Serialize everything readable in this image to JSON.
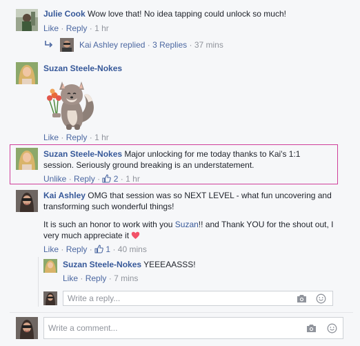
{
  "comments": [
    {
      "author": "Julie Cook",
      "text": "Wow love that! No idea tapping could unlock so much!",
      "actions": {
        "like": "Like",
        "reply": "Reply",
        "time": "1 hr"
      },
      "replies_summary": {
        "author": "Kai Ashley",
        "verb": "replied",
        "count": "3 Replies",
        "time": "37 mins"
      }
    },
    {
      "author": "Suzan Steele-Nokes",
      "sticker": "fox-with-flowers sticker",
      "actions": {
        "like": "Like",
        "reply": "Reply",
        "time": "1 hr"
      }
    },
    {
      "author": "Suzan Steele-Nokes",
      "text_line1": "Major unlocking for me today thanks to Kai's 1:1",
      "text_line2": "session. Seriously ground breaking is an understatement.",
      "actions": {
        "like": "Unlike",
        "reply": "Reply",
        "reactions": "2",
        "time": "1 hr"
      }
    },
    {
      "author": "Kai Ashley",
      "text_line1": "OMG that session was so NEXT LEVEL - what fun uncovering and",
      "text_line2": "transforming such wonderful things!",
      "para2_line1_a": "It is such an honor to work with you ",
      "para2_mention": "Suzan",
      "para2_line1_b": "!! and Thank YOU for the shout out, I",
      "para2_line2": "very much appreciate it",
      "actions": {
        "like": "Like",
        "reply": "Reply",
        "reactions": "1",
        "time": "40 mins"
      }
    }
  ],
  "nested_reply": {
    "author": "Suzan Steele-Nokes",
    "text": "YEEEAASSS!",
    "actions": {
      "like": "Like",
      "reply": "Reply",
      "time": "7 mins"
    }
  },
  "reply_input": {
    "placeholder": "Write a reply..."
  },
  "comment_input": {
    "placeholder": "Write a comment..."
  },
  "colors": {
    "name": "#365899",
    "link": "#4b67a1",
    "muted": "#90949c",
    "highlight_border": "#cf3d9a",
    "heart": "#f25268"
  },
  "icons": [
    "reply-arrow-icon",
    "thumbs-up-icon",
    "heart-emoji-icon",
    "camera-icon",
    "smiley-icon"
  ]
}
